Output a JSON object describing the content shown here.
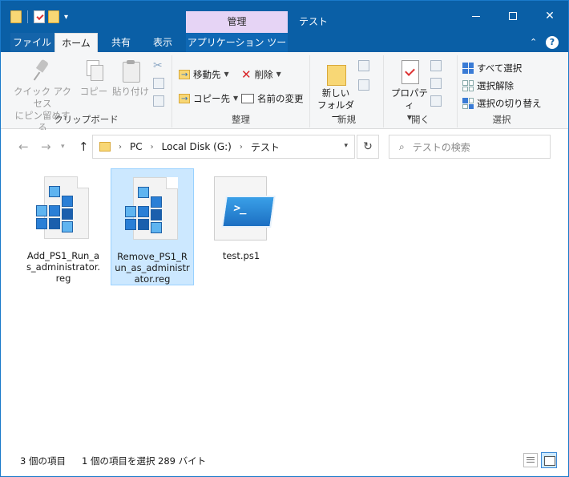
{
  "titlebar": {
    "context_tab": "管理",
    "title": "テスト"
  },
  "tabs": [
    {
      "label": "ファイル"
    },
    {
      "label": "ホーム"
    },
    {
      "label": "共有"
    },
    {
      "label": "表示"
    },
    {
      "label": "アプリケーション ツール"
    }
  ],
  "ribbon": {
    "clipboard": {
      "group": "クリップボード",
      "pin_line1": "クイック アクセス",
      "pin_line2": "にピン留めする",
      "copy": "コピー",
      "paste": "貼り付け"
    },
    "organize": {
      "group": "整理",
      "move_to": "移動先",
      "copy_to": "コピー先",
      "delete": "削除",
      "rename": "名前の変更"
    },
    "new": {
      "group": "新規",
      "new_folder_line1": "新しい",
      "new_folder_line2": "フォルダー"
    },
    "open": {
      "group": "開く",
      "properties": "プロパティ"
    },
    "select": {
      "group": "選択",
      "select_all": "すべて選択",
      "select_none": "選択解除",
      "invert": "選択の切り替え"
    }
  },
  "address": {
    "crumbs": [
      "PC",
      "Local Disk (G:)",
      "テスト"
    ],
    "search_placeholder": "テストの検索"
  },
  "files": [
    {
      "name": "Add_PS1_Run_as_administrator.reg",
      "type": "registry-file-icon",
      "selected": false
    },
    {
      "name": "Remove_PS1_Run_as_administrator.reg",
      "type": "registry-file-icon",
      "selected": true
    },
    {
      "name": "test.ps1",
      "type": "powershell-file-icon",
      "selected": false
    }
  ],
  "status": {
    "count": "3 個の項目",
    "selection": "1 個の項目を選択",
    "size": "289 バイト"
  }
}
